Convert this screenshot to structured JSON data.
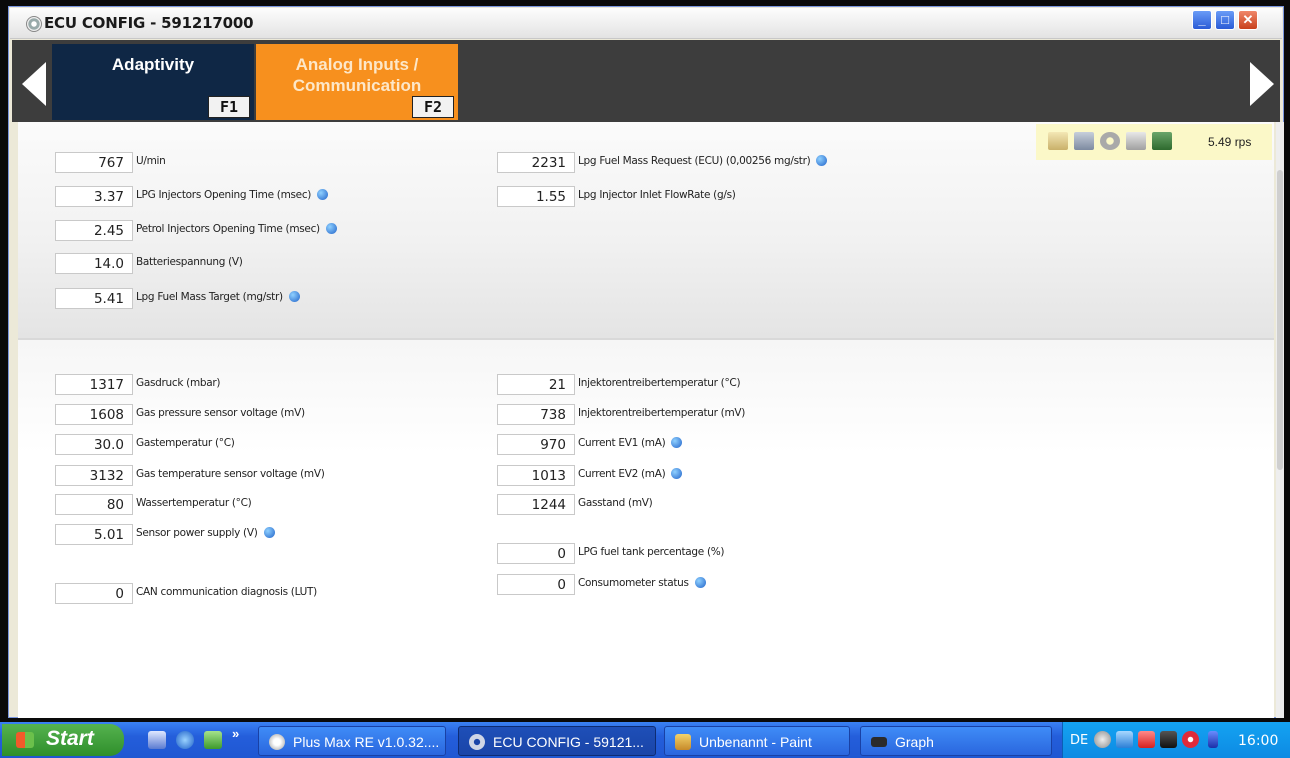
{
  "window": {
    "title": "ECU CONFIG - 591217000",
    "buttons": {
      "minimize": "_",
      "maximize": "□",
      "close": "✕"
    }
  },
  "tabs": [
    {
      "label_line1": "Adaptivity",
      "label_line2": "",
      "fkey": "F1",
      "active": false,
      "color": "#0f2745"
    },
    {
      "label_line1": "Analog Inputs /",
      "label_line2": "Communication",
      "fkey": "F2",
      "active": true,
      "color": "#f7901e"
    }
  ],
  "toolbar": {
    "icons": [
      "open-folder-icon",
      "save-icon",
      "gear-icon",
      "clipboard-icon",
      "monitor-icon"
    ],
    "rate": "5.49 rps"
  },
  "panel_top": {
    "left": [
      {
        "value": "767",
        "label": "U/min",
        "info": false
      },
      {
        "value": "3.37",
        "label": "LPG Injectors Opening Time (msec)",
        "info": true
      },
      {
        "value": "2.45",
        "label": "Petrol Injectors Opening Time (msec)",
        "info": true
      },
      {
        "value": "14.0",
        "label": "Batteriespannung (V)",
        "info": false
      },
      {
        "value": "5.41",
        "label": "Lpg Fuel Mass Target (mg/str)",
        "info": true
      }
    ],
    "right": [
      {
        "value": "2231",
        "label": "Lpg Fuel Mass Request (ECU) (0,00256 mg/str)",
        "info": true
      },
      {
        "value": "1.55",
        "label": "Lpg Injector Inlet FlowRate (g/s)",
        "info": false
      }
    ]
  },
  "panel_bottom": {
    "left": [
      {
        "value": "1317",
        "label": "Gasdruck (mbar)",
        "info": false
      },
      {
        "value": "1608",
        "label": "Gas pressure sensor voltage (mV)",
        "info": false
      },
      {
        "value": "30.0",
        "label": "Gastemperatur (°C)",
        "info": false
      },
      {
        "value": "3132",
        "label": "Gas temperature sensor voltage (mV)",
        "info": false
      },
      {
        "value": "80",
        "label": "Wassertemperatur (°C)",
        "info": false
      },
      {
        "value": "5.01",
        "label": "Sensor power supply (V)",
        "info": true
      },
      {
        "value": "0",
        "label": "CAN communication diagnosis (LUT)",
        "info": false
      }
    ],
    "right": [
      {
        "value": "21",
        "label": "Injektorentreibertemperatur (°C)",
        "info": false
      },
      {
        "value": "738",
        "label": "Injektorentreibertemperatur (mV)",
        "info": false
      },
      {
        "value": "970",
        "label": "Current EV1 (mA)",
        "info": true
      },
      {
        "value": "1013",
        "label": "Current EV2 (mA)",
        "info": true
      },
      {
        "value": "1244",
        "label": "Gasstand (mV)",
        "info": false
      },
      {
        "value": "0",
        "label": "LPG fuel tank percentage (%)",
        "info": false
      },
      {
        "value": "0",
        "label": "Consumometer status",
        "info": true
      }
    ]
  },
  "taskbar": {
    "start": "Start",
    "more": "»",
    "tasks": [
      {
        "label": "Plus Max RE v1.0.32....",
        "icon": "pluxmax-icon",
        "active": false
      },
      {
        "label": "ECU CONFIG - 59121...",
        "icon": "gear-icon",
        "active": true
      },
      {
        "label": "Unbenannt - Paint",
        "icon": "paint-icon",
        "active": false
      },
      {
        "label": "Graph",
        "icon": "graph-icon",
        "active": false
      }
    ],
    "language": "DE",
    "clock": "16:00"
  }
}
